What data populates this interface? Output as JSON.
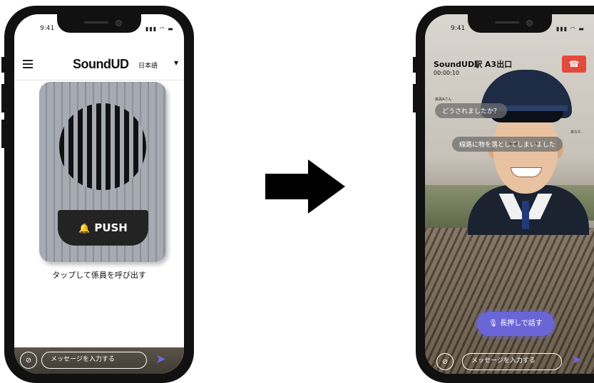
{
  "left_phone": {
    "status_time": "9:41",
    "status_icons": "▮▮▮ ◠ ▬",
    "app_logo": "SoundUD",
    "language": "日本語",
    "push_label": "PUSH",
    "tap_caption": "タップして係員を呼び出す",
    "message_placeholder": "メッセージを入力する"
  },
  "right_phone": {
    "status_time": "9:41",
    "status_icons": "▮▮▮ ◠ ▬",
    "call_title": "SoundUD駅 A3出口",
    "call_timer": "00:00:10",
    "staff_label": "係員Aさん",
    "staff_message": "どうされましたか？",
    "user_label": "あなた",
    "user_message": "線路に物を落としてしまいました",
    "push_to_talk_label": "長押しで話す",
    "message_placeholder": "メッセージを入力する"
  },
  "colors": {
    "accent_purple": "#6b66d8",
    "hangup_red": "#e44a3b"
  },
  "icons": {
    "menu": "hamburger-icon",
    "bell": "bell-icon",
    "hangup": "phone-hangup-icon",
    "camera_off": "camera-off-icon",
    "mic": "mic-icon",
    "send": "send-icon"
  }
}
